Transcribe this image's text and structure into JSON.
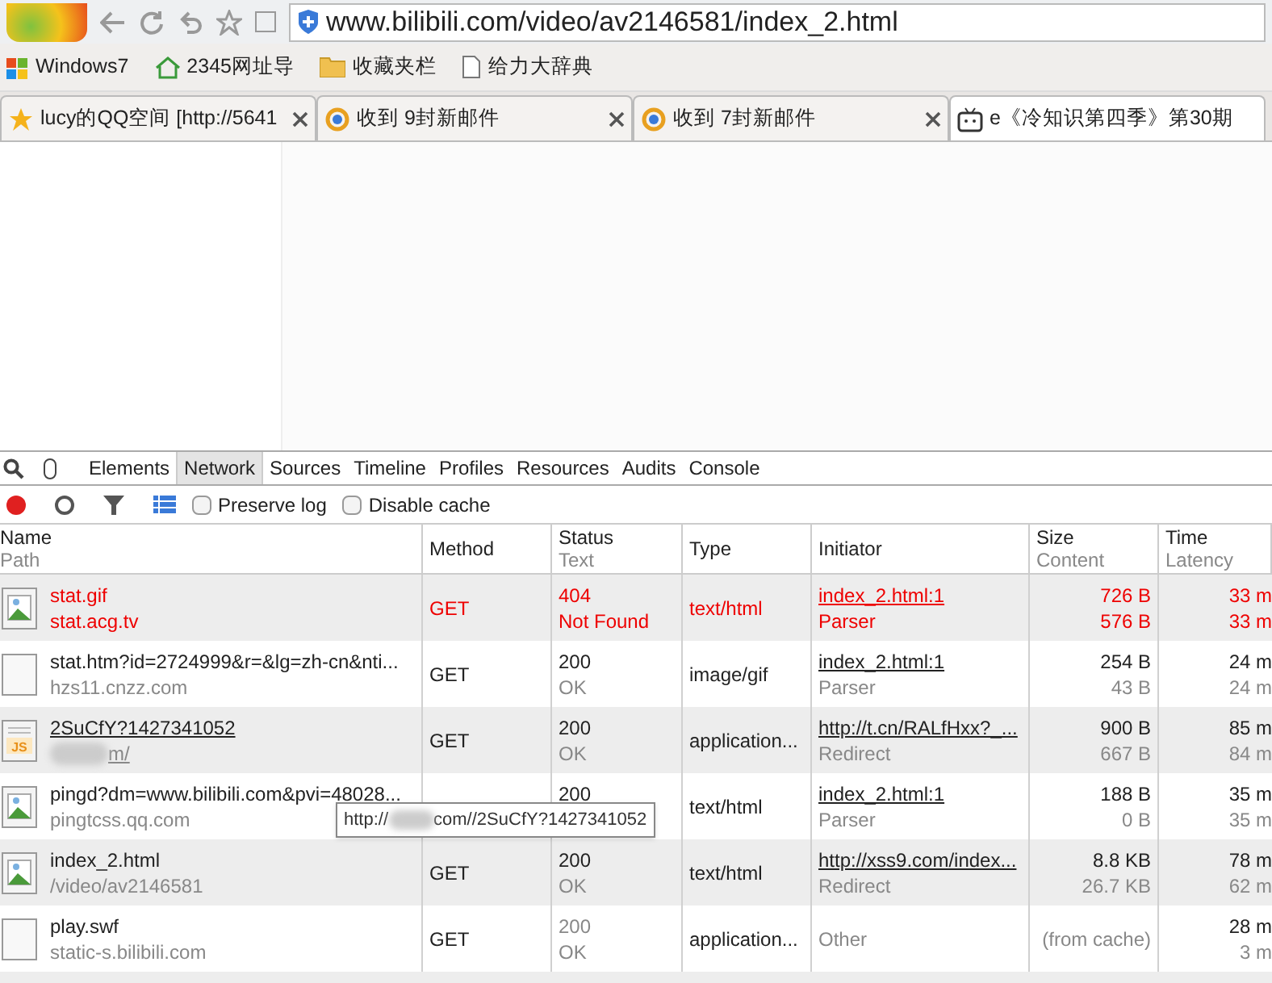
{
  "address_bar": {
    "url": "www.bilibili.com/video/av2146581/index_2.html"
  },
  "bookmarks": [
    {
      "label": "Windows7",
      "kind": "windows"
    },
    {
      "label": "2345网址导",
      "kind": "house"
    },
    {
      "label": "收藏夹栏",
      "kind": "folder"
    },
    {
      "label": "给力大辞典",
      "kind": "page"
    }
  ],
  "tabs": [
    {
      "label": "lucy的QQ空间 [http://5641",
      "kind": "star",
      "selected": false
    },
    {
      "label": "收到 9封新邮件",
      "kind": "mail",
      "selected": false
    },
    {
      "label": "收到 7封新邮件",
      "kind": "mail",
      "selected": false
    },
    {
      "label": "e《冷知识第四季》第30期",
      "kind": "tv",
      "selected": true
    }
  ],
  "devtools_tabs": [
    {
      "label": "Elements",
      "selected": false
    },
    {
      "label": "Network",
      "selected": true
    },
    {
      "label": "Sources",
      "selected": false
    },
    {
      "label": "Timeline",
      "selected": false
    },
    {
      "label": "Profiles",
      "selected": false
    },
    {
      "label": "Resources",
      "selected": false
    },
    {
      "label": "Audits",
      "selected": false
    },
    {
      "label": "Console",
      "selected": false
    }
  ],
  "toolbar": {
    "recording": true,
    "preserve_log": {
      "label": "Preserve log",
      "checked": false
    },
    "disable_cache": {
      "label": "Disable cache",
      "checked": false
    }
  },
  "columns": [
    {
      "title": "Name",
      "subtitle": "Path"
    },
    {
      "title": "Method"
    },
    {
      "title": "Status",
      "subtitle": "Text"
    },
    {
      "title": "Type"
    },
    {
      "title": "Initiator"
    },
    {
      "title": "Size",
      "subtitle": "Content"
    },
    {
      "title": "Time",
      "subtitle": "Latency"
    }
  ],
  "rows": [
    {
      "error": true,
      "kind": "image",
      "name": "stat.gif",
      "path": "stat.acg.tv",
      "link": false,
      "method": "GET",
      "status": "404",
      "status_text": "Not Found",
      "type": "text/html",
      "initiator": "index_2.html:1",
      "initiator_detail": "Parser",
      "size": "726 B",
      "content": "576 B",
      "time": "33 m",
      "latency": "33 m",
      "cached": false
    },
    {
      "error": false,
      "kind": "blank",
      "name": "stat.htm?id=2724999&r=&lg=zh-cn&nti...",
      "path": "hzs11.cnzz.com",
      "link": false,
      "method": "GET",
      "status": "200",
      "status_text": "OK",
      "type": "image/gif",
      "initiator": "index_2.html:1",
      "initiator_detail": "Parser",
      "size": "254 B",
      "content": "43 B",
      "time": "24 m",
      "latency": "24 m",
      "cached": false
    },
    {
      "error": false,
      "kind": "script",
      "badge": "JS",
      "name": "2SuCfY?1427341052",
      "path": "m/",
      "link": true,
      "method": "GET",
      "status": "200",
      "status_text": "OK",
      "type": "application...",
      "initiator": "http://t.cn/RALfHxx?_...",
      "initiator_detail": "Redirect",
      "size": "900 B",
      "content": "667 B",
      "time": "85 m",
      "latency": "84 m",
      "cached": false
    },
    {
      "error": false,
      "kind": "image",
      "name": "pingd?dm=www.bilibili.com&pvi=48028...",
      "path": "pingtcss.qq.com",
      "link": false,
      "status": "200",
      "type": "text/html",
      "initiator": "index_2.html:1",
      "initiator_detail": "Parser",
      "size": "188 B",
      "content": "0 B",
      "time": "35 m",
      "latency": "35 m",
      "cached": false
    },
    {
      "error": false,
      "kind": "image",
      "name": "index_2.html",
      "path": "/video/av2146581",
      "link": false,
      "method": "GET",
      "status": "200",
      "status_text": "OK",
      "type": "text/html",
      "initiator": "http://xss9.com/index...",
      "initiator_detail": "Redirect",
      "size": "8.8 KB",
      "content": "26.7 KB",
      "time": "78 m",
      "latency": "62 m",
      "cached": false
    },
    {
      "error": false,
      "kind": "blank",
      "name": "play.swf",
      "path": "static-s.bilibili.com",
      "link": false,
      "method": "GET",
      "status": "200",
      "status_text": "OK",
      "type": "application...",
      "initiator": "Other",
      "size": "(from cache)",
      "time": "28 m",
      "latency": "3 m",
      "cached": true
    }
  ],
  "tooltip": {
    "prefix": "http://",
    "suffix": "com//2SuCfY?1427341052"
  }
}
